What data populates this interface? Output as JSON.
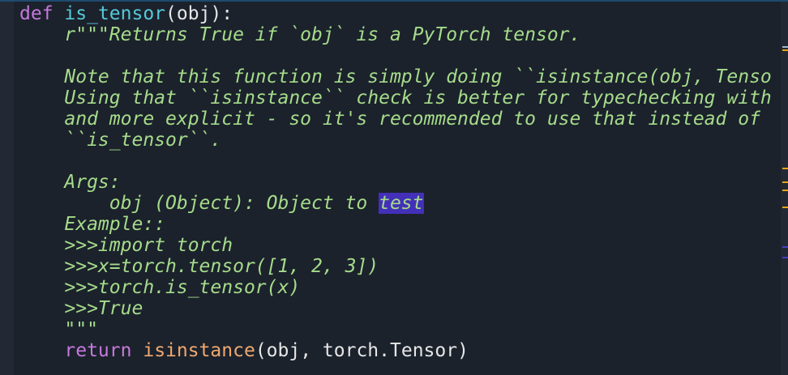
{
  "editor": {
    "signature": {
      "keyword": "def",
      "name": "is_tensor",
      "params": "(obj):"
    },
    "docstring_lines": [
      "    r\"\"\"Returns True if `obj` is a PyTorch tensor.",
      "",
      "    Note that this function is simply doing ``isinstance(obj, Tenso",
      "    Using that ``isinstance`` check is better for typechecking with",
      "    and more explicit - so it's recommended to use that instead of",
      "    ``is_tensor``.",
      "",
      "    Args:",
      "        obj (Object): Object to "
    ],
    "highlighted_word": "test",
    "docstring_tail": [
      "    Example::",
      "    >>>import torch",
      "    >>>x=torch.tensor([1, 2, 3])",
      "    >>>torch.is_tensor(x)",
      "    >>>True",
      "    \"\"\""
    ],
    "return_line": {
      "indent": "    ",
      "keyword": "return",
      "builtin": "isinstance",
      "rest": "(obj, torch.Tensor)"
    }
  },
  "colors": {
    "background": "#1b222c",
    "keyword": "#c678dd",
    "function": "#56c8d8",
    "docstring": "#a6db8a",
    "builtin": "#f0a870",
    "highlight": "#4330b8"
  }
}
